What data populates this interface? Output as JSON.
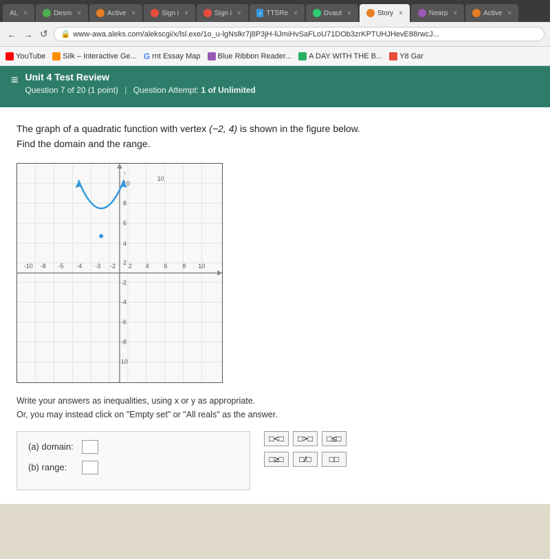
{
  "browser": {
    "tabs": [
      {
        "label": "AL",
        "icon_color": "#555",
        "active": false,
        "close": "×"
      },
      {
        "label": "Desm",
        "icon_color": "#4CAF50",
        "active": false,
        "close": "×"
      },
      {
        "label": "Active",
        "icon_color": "#e67e22",
        "active": false,
        "close": "×"
      },
      {
        "label": "Sign i",
        "icon_color": "#e74c3c",
        "active": false,
        "close": "×"
      },
      {
        "label": "Sign i",
        "icon_color": "#e74c3c",
        "active": false,
        "close": "×"
      },
      {
        "label": "TTSRe",
        "icon_color": "#3498db",
        "active": false,
        "close": "×"
      },
      {
        "label": "Dvaut",
        "icon_color": "#2ecc71",
        "active": false,
        "close": "×"
      },
      {
        "label": "Story",
        "icon_color": "#e67e22",
        "active": false,
        "close": "×"
      },
      {
        "label": "Nearp",
        "icon_color": "#9b59b6",
        "active": false,
        "close": "×"
      },
      {
        "label": "Active",
        "icon_color": "#e67e22",
        "active": false,
        "close": "×"
      }
    ],
    "url": "www-awa.aleks.com/alekscgi/x/lsl.exe/1o_u-lgNslkr7j8P3jH-liJmiHvSaFLoU71DOb3zrKPTUHJHevE88rwcJ...",
    "url_icon": "🔒"
  },
  "bookmarks": [
    {
      "label": "YouTube",
      "color": "#ff0000"
    },
    {
      "label": "Silk – Interactive Ge...",
      "color": "#ff8c00"
    },
    {
      "label": "rnt Essay Map",
      "color": "#4285F4"
    },
    {
      "label": "Blue Ribbon Reader...",
      "color": "#9b59b6"
    },
    {
      "label": "A DAY WITH THE B...",
      "color": "#27ae60"
    },
    {
      "label": "Y8 Gar",
      "color": "#e74c3c"
    }
  ],
  "header": {
    "title": "Unit 4 Test Review",
    "question_info": "Question 7 of 20 (1 point)",
    "attempt_info": "Question Attempt: ",
    "attempt_value": "1 of Unlimited"
  },
  "question": {
    "text_part1": "The graph of a quadratic function with vertex ",
    "vertex": "(−2, 4)",
    "text_part2": " is shown in the figure below.",
    "text_part3": "Find the domain and the range."
  },
  "instructions": {
    "line1": "Write your answers as inequalities, using x or y as appropriate.",
    "line2": "Or, you may instead click on \"Empty set\" or \"All reals\" as the answer."
  },
  "answer_fields": {
    "domain_label": "(a)    domain:",
    "range_label": "(b)    range:"
  },
  "symbols": {
    "row1": [
      "□<□",
      "□>□",
      "□≤□"
    ],
    "row2": [
      "□≥□",
      "□/□",
      "□□"
    ]
  }
}
